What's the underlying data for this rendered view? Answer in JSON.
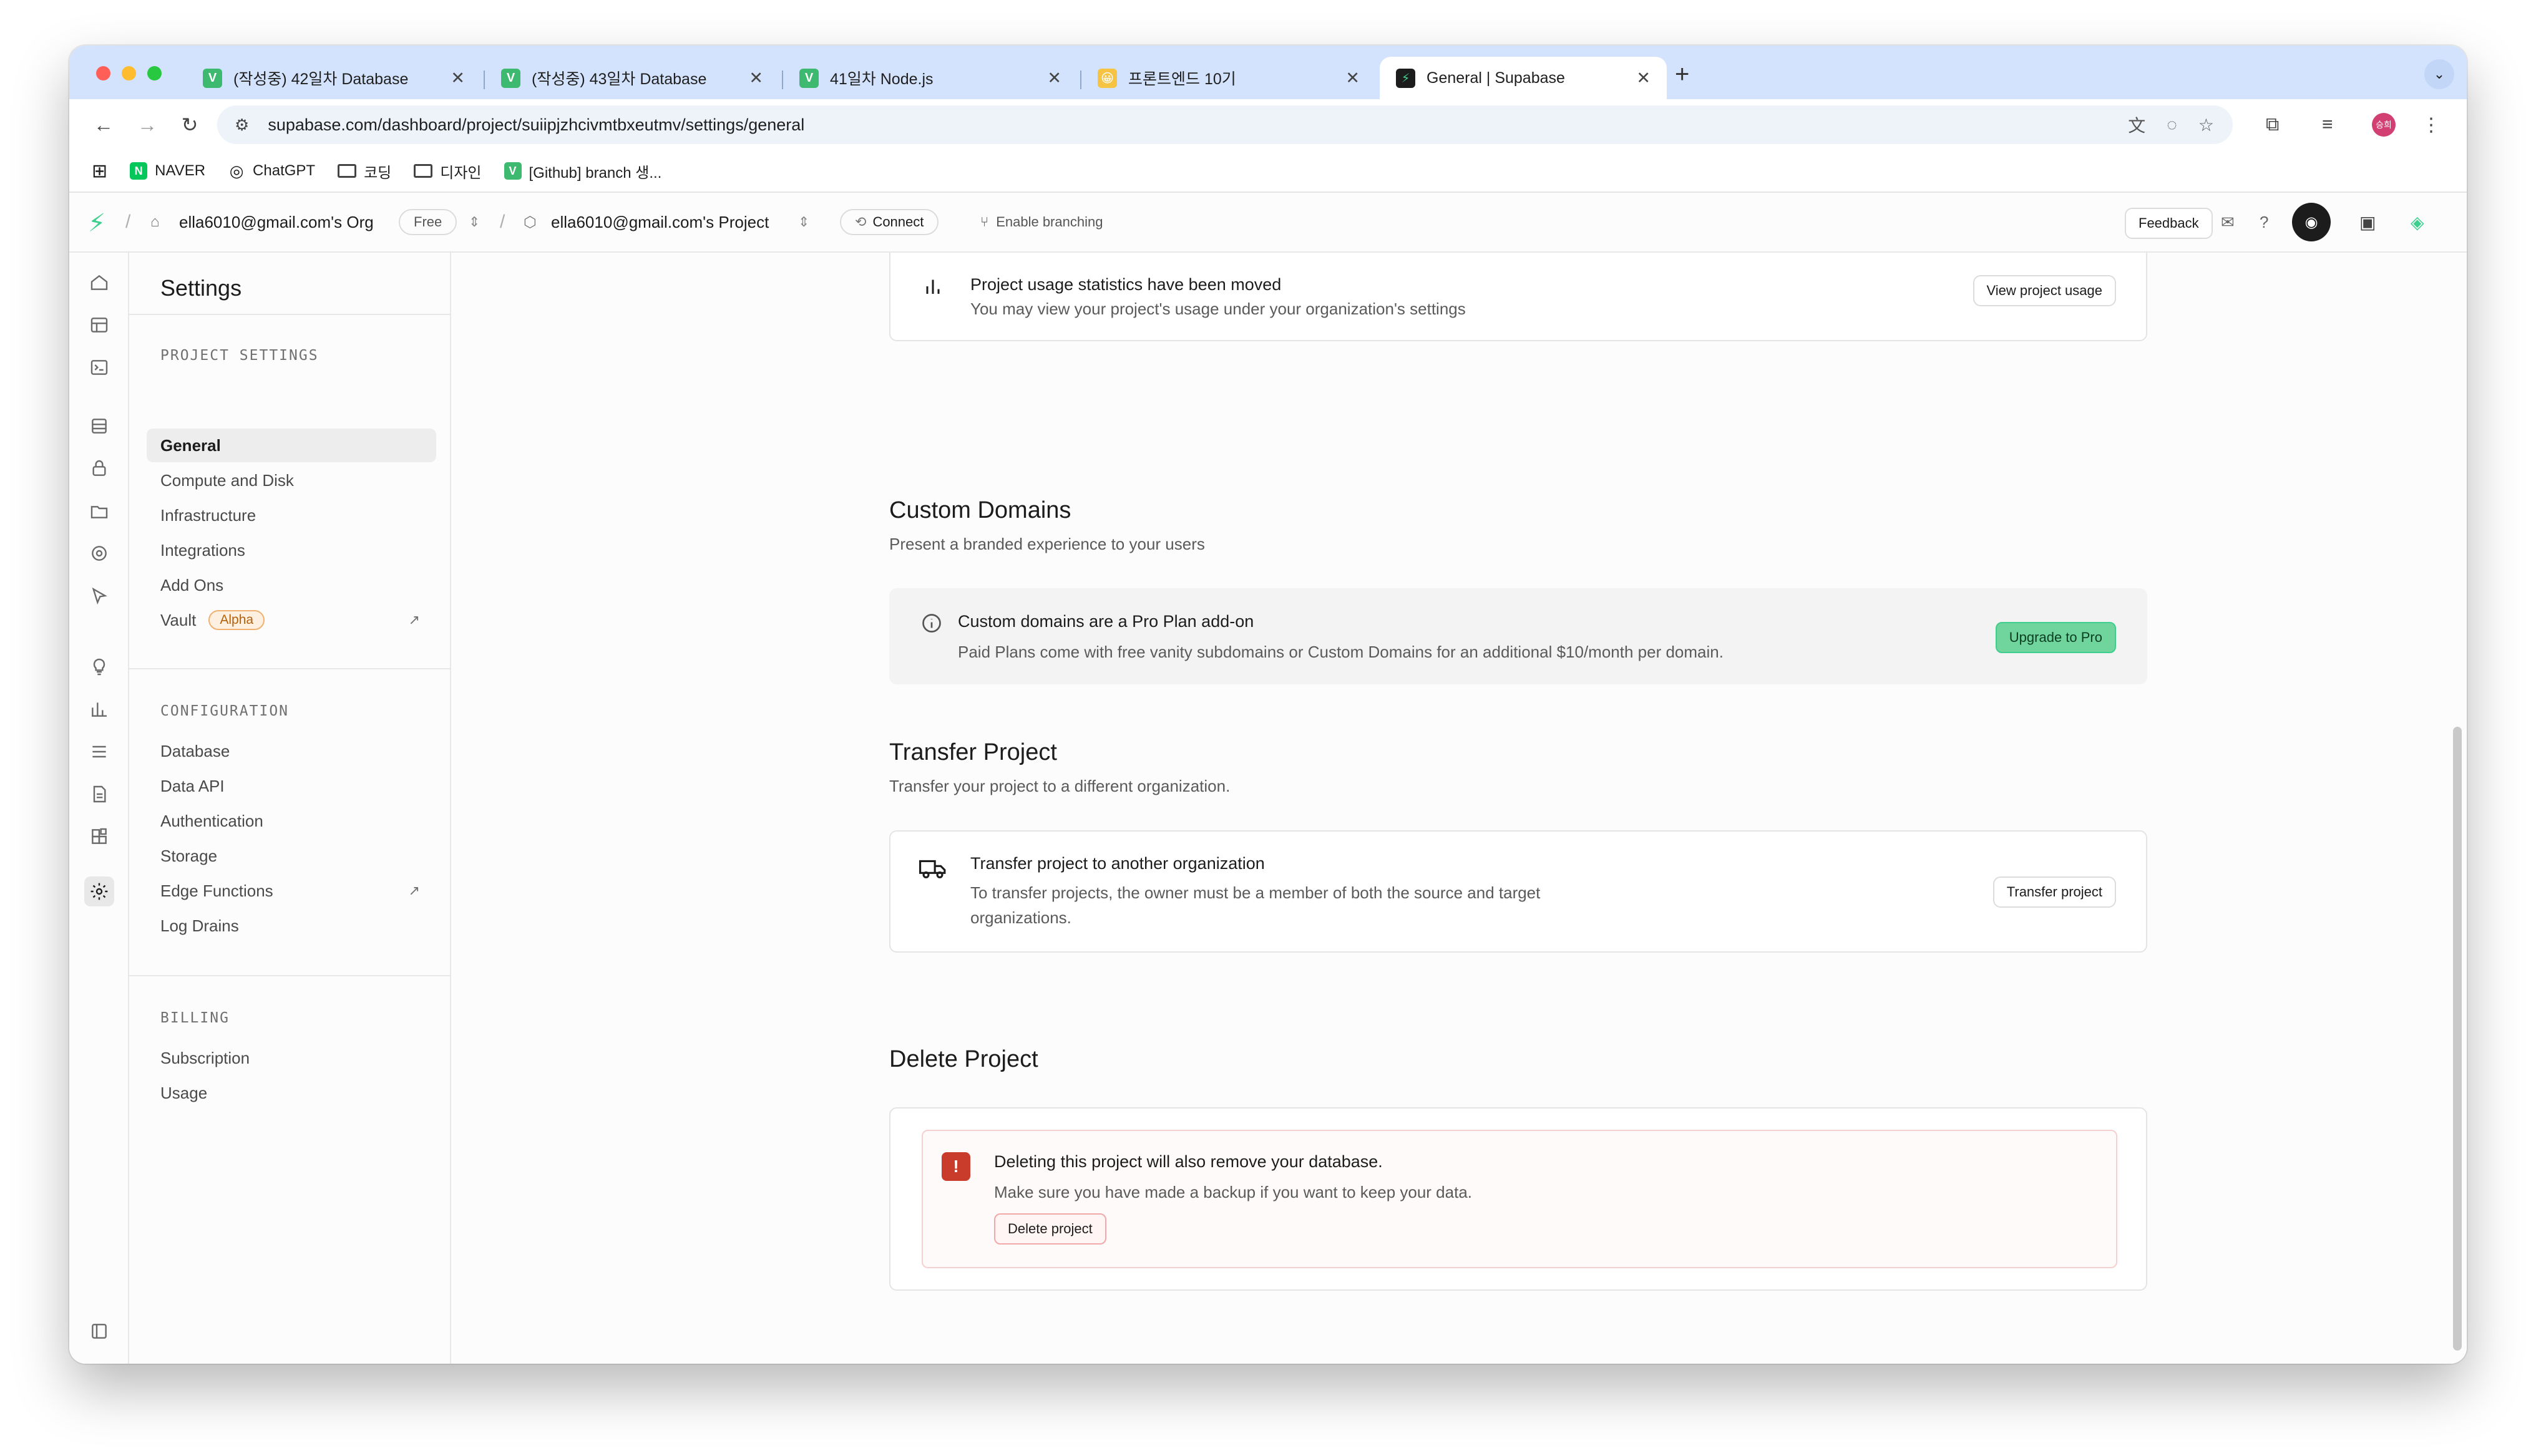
{
  "browser": {
    "tabs": [
      {
        "title": "(작성중) 42일차 Database",
        "favicon": "V"
      },
      {
        "title": "(작성중) 43일차 Database",
        "favicon": "V"
      },
      {
        "title": "41일차 Node.js",
        "favicon": "V"
      },
      {
        "title": "프론트엔드 10기",
        "favicon": "😀"
      },
      {
        "title": "General | Supabase",
        "favicon": "⚡"
      }
    ],
    "url": "supabase.com/dashboard/project/suiipjzhcivmtbxeutmv/settings/general",
    "bookmarks": [
      {
        "label": "NAVER",
        "icon": "N",
        "color": "#03c75a"
      },
      {
        "label": "ChatGPT",
        "icon": "◎",
        "color": "#1c1c1c"
      },
      {
        "label": "코딩",
        "icon": "folder"
      },
      {
        "label": "디자인",
        "icon": "folder"
      },
      {
        "label": "[Github] branch 생...",
        "icon": "V",
        "color": "#3dba6f"
      }
    ],
    "profile_initials": "승희"
  },
  "header": {
    "org_name": "ella6010@gmail.com's Org",
    "plan_badge": "Free",
    "project_name": "ella6010@gmail.com's Project",
    "connect_label": "Connect",
    "branching_label": "Enable branching",
    "feedback_label": "Feedback"
  },
  "sidebar": {
    "title": "Settings",
    "sections": [
      {
        "label": "PROJECT SETTINGS",
        "items": [
          {
            "label": "General",
            "active": true
          },
          {
            "label": "Compute and Disk"
          },
          {
            "label": "Infrastructure"
          },
          {
            "label": "Integrations"
          },
          {
            "label": "Add Ons"
          },
          {
            "label": "Vault",
            "badge": "Alpha",
            "external": true
          }
        ]
      },
      {
        "label": "CONFIGURATION",
        "items": [
          {
            "label": "Database"
          },
          {
            "label": "Data API"
          },
          {
            "label": "Authentication"
          },
          {
            "label": "Storage"
          },
          {
            "label": "Edge Functions",
            "external": true
          },
          {
            "label": "Log Drains"
          }
        ]
      },
      {
        "label": "BILLING",
        "items": [
          {
            "label": "Subscription"
          },
          {
            "label": "Usage"
          }
        ]
      }
    ]
  },
  "main": {
    "usage": {
      "title": "Project usage statistics have been moved",
      "desc": "You may view your project's usage under your organization's settings",
      "button": "View project usage"
    },
    "custom_domains": {
      "heading": "Custom Domains",
      "subheading": "Present a branded experience to your users",
      "notice_title": "Custom domains are a Pro Plan add-on",
      "notice_desc": "Paid Plans come with free vanity subdomains or Custom Domains for an additional $10/month per domain.",
      "button": "Upgrade to Pro"
    },
    "transfer": {
      "heading": "Transfer Project",
      "subheading": "Transfer your project to a different organization.",
      "card_title": "Transfer project to another organization",
      "card_desc_1": "To transfer projects, the owner must be a member of both the source and target",
      "card_desc_2": "organizations.",
      "button": "Transfer project"
    },
    "delete": {
      "heading": "Delete Project",
      "warning_title": "Deleting this project will also remove your database.",
      "warning_desc": "Make sure you have made a backup if you want to keep your data.",
      "button": "Delete project"
    }
  },
  "colors": {
    "brand": "#3ecf8e",
    "danger": "#c93b2a",
    "tabstrip": "#d3e3fd"
  }
}
